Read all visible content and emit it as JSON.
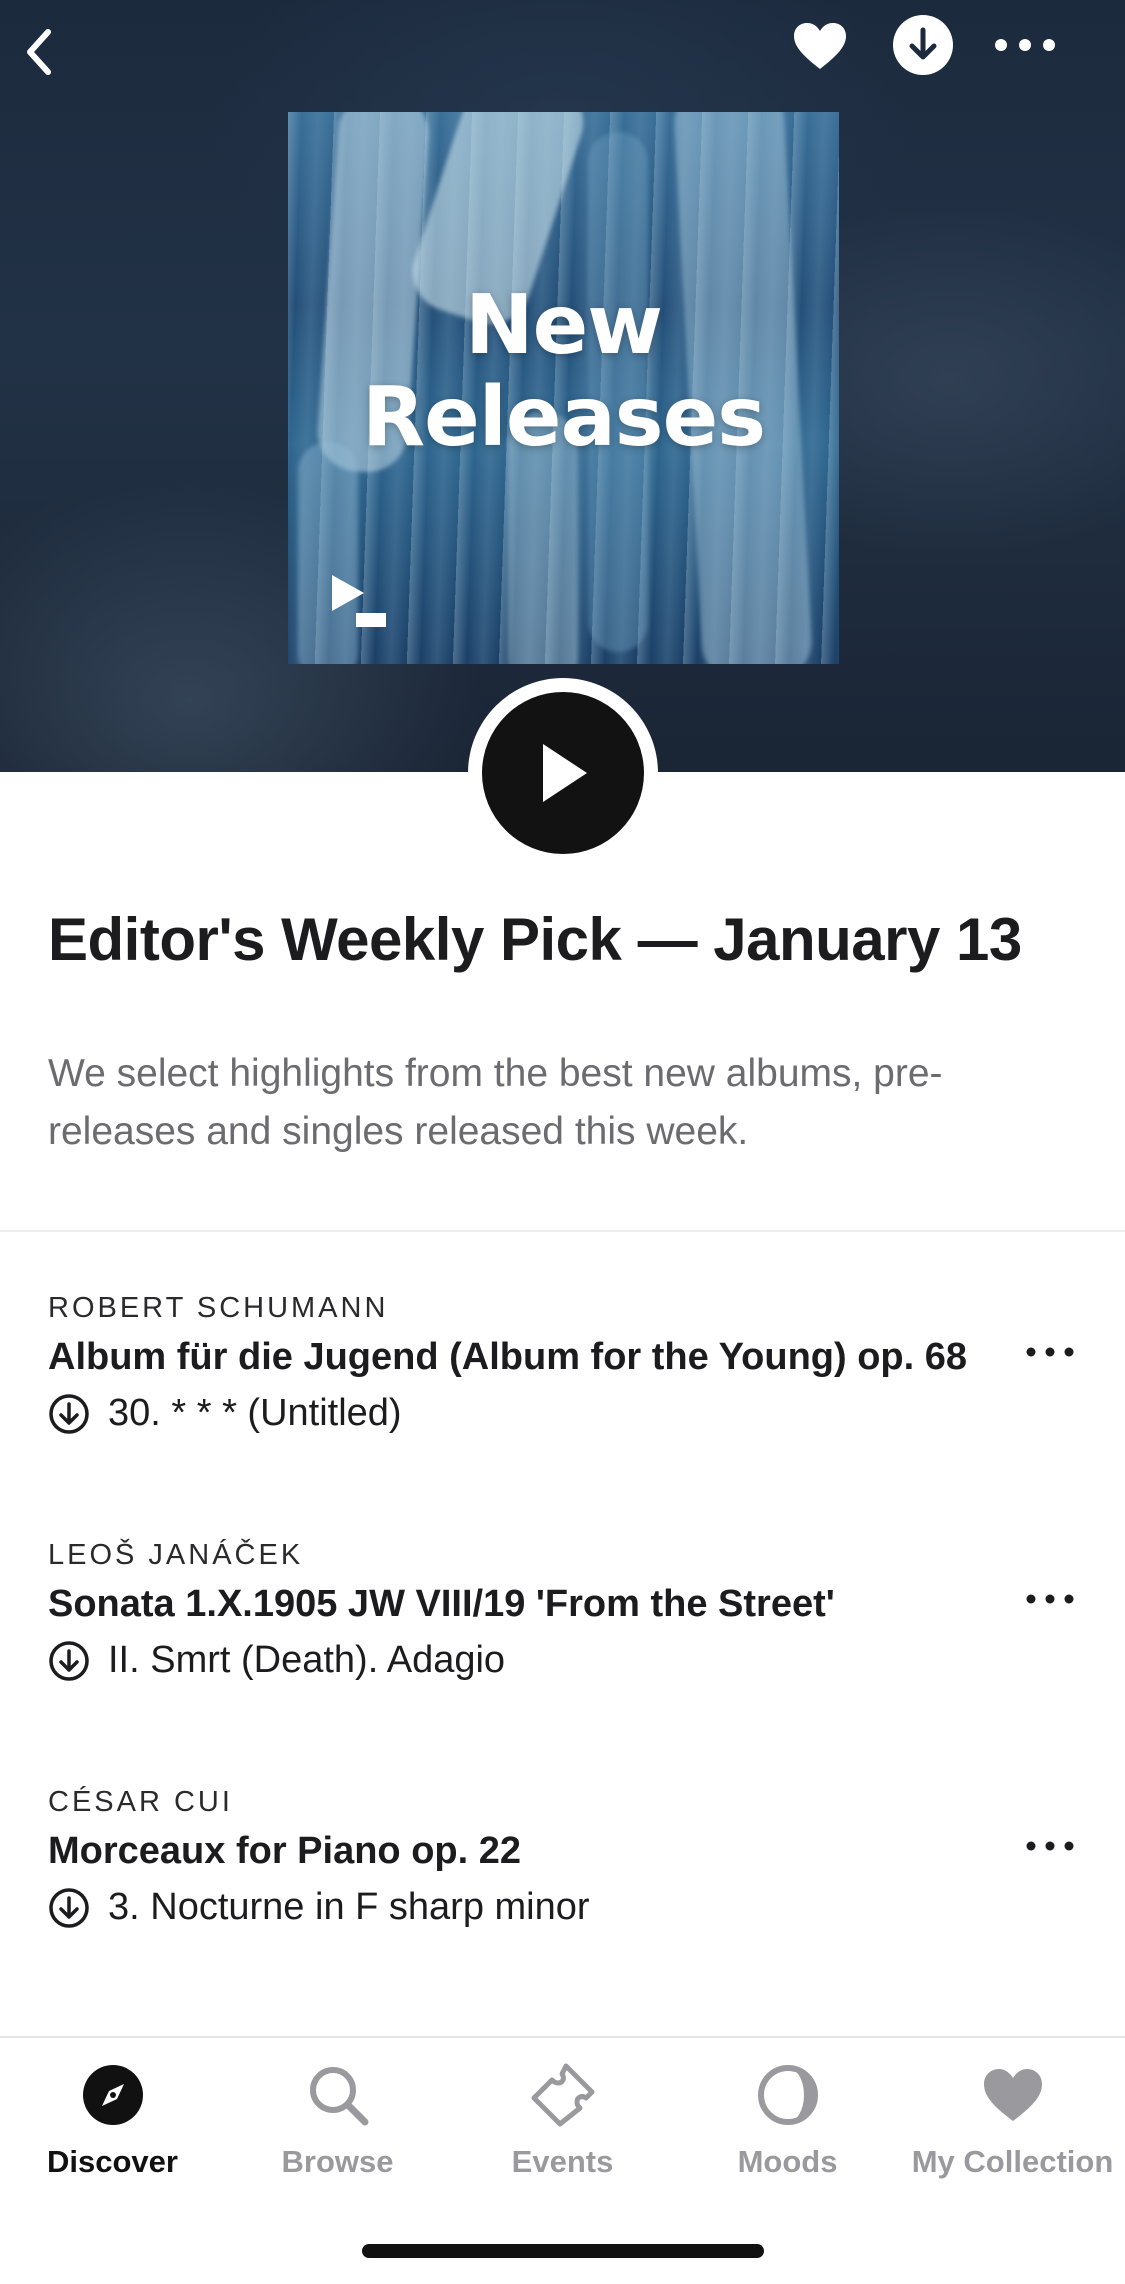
{
  "header": {
    "back_icon": "chevron-left-icon",
    "favorite_icon": "heart-icon",
    "download_icon": "download-icon",
    "more_icon": "more-horizontal-icon"
  },
  "cover": {
    "title_line1": "New",
    "title_line2": "Releases",
    "logo_icon": "play-logo-icon"
  },
  "playlist": {
    "title": "Editor's Weekly Pick — January 13",
    "description": "We select highlights from the best new albums, pre-releases and singles released this week."
  },
  "tracks": [
    {
      "composer": "ROBERT SCHUMANN",
      "work": "Album für die Jugend (Album for the Young) op. 68",
      "movement": "30. * * * (Untitled)"
    },
    {
      "composer": "LEOŠ JANÁČEK",
      "work": "Sonata 1.X.1905 JW VIII/19 'From the Street'",
      "movement": "II. Smrt (Death). Adagio"
    },
    {
      "composer": "CÉSAR CUI",
      "work": "Morceaux for Piano op. 22",
      "movement": "3. Nocturne in F sharp minor"
    }
  ],
  "tabbar": {
    "items": [
      {
        "label": "Discover",
        "icon": "compass-icon",
        "active": true
      },
      {
        "label": "Browse",
        "icon": "search-icon",
        "active": false
      },
      {
        "label": "Events",
        "icon": "ticket-icon",
        "active": false
      },
      {
        "label": "Moods",
        "icon": "moon-icon",
        "active": false
      },
      {
        "label": "My Collection",
        "icon": "heart-icon",
        "active": false
      }
    ]
  },
  "colors": {
    "accent": "#121212",
    "inactive_tab": "#9a9a9e",
    "description_text": "#6b6b70"
  }
}
